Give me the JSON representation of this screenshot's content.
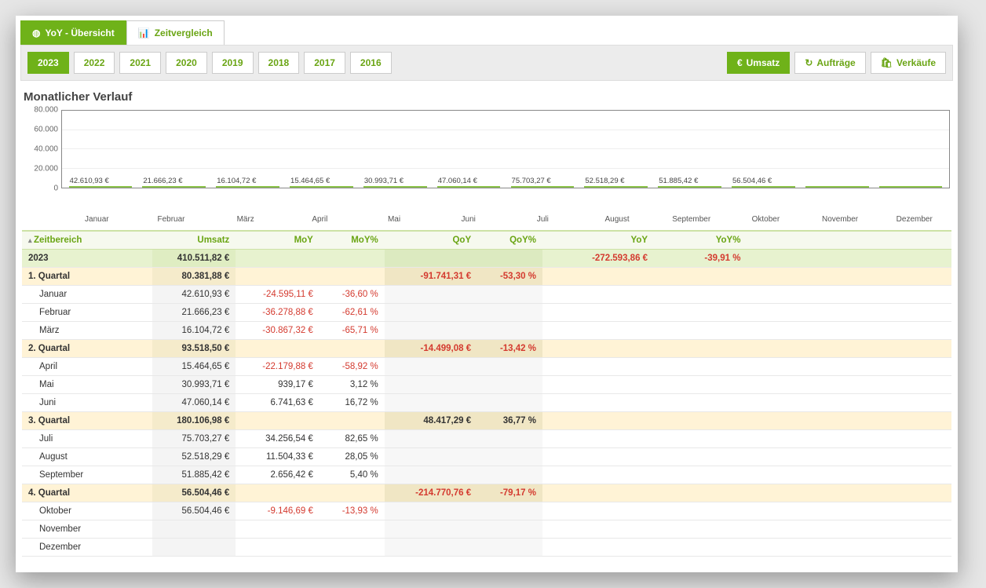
{
  "tabs_primary": [
    {
      "id": "overview",
      "label": "YoY - Übersicht",
      "active": true,
      "icon": "globe"
    },
    {
      "id": "compare",
      "label": "Zeitvergleich",
      "active": false,
      "icon": "chart"
    }
  ],
  "years": [
    "2023",
    "2022",
    "2021",
    "2020",
    "2019",
    "2018",
    "2017",
    "2016"
  ],
  "year_active": "2023",
  "metrics": [
    {
      "id": "umsatz",
      "label": "Umsatz",
      "icon": "€",
      "active": true
    },
    {
      "id": "auftraege",
      "label": "Aufträge",
      "icon": "↻",
      "active": false
    },
    {
      "id": "verkaeufe",
      "label": "Verkäufe",
      "icon": "🛍",
      "active": false
    }
  ],
  "chart_title": "Monatlicher Verlauf",
  "chart_data": {
    "type": "bar",
    "categories": [
      "Januar",
      "Februar",
      "März",
      "April",
      "Mai",
      "Juni",
      "Juli",
      "August",
      "September",
      "Oktober",
      "November",
      "Dezember"
    ],
    "values": [
      42610.93,
      21666.23,
      16104.72,
      15464.65,
      30993.71,
      47060.14,
      75703.27,
      52518.29,
      51885.42,
      56504.46,
      0,
      0
    ],
    "value_labels": [
      "42.610,93 €",
      "21.666,23 €",
      "16.104,72 €",
      "15.464,65 €",
      "30.993,71 €",
      "47.060,14 €",
      "75.703,27 €",
      "52.518,29 €",
      "51.885,42 €",
      "56.504,46 €",
      "",
      ""
    ],
    "ylabel": "",
    "xlabel": "",
    "ylim": [
      0,
      80000
    ],
    "y_ticks": [
      0,
      20000,
      40000,
      60000,
      80000
    ]
  },
  "table": {
    "columns": [
      "Zeitbereich",
      "Umsatz",
      "MoY",
      "MoY%",
      "QoY",
      "QoY%",
      "YoY",
      "YoY%"
    ],
    "rows": [
      {
        "level": "year",
        "range": "2023",
        "umsatz": "410.511,82 €",
        "moy": "",
        "moyp": "",
        "qoy": "",
        "qoyp": "",
        "yoy": "-272.593,86 €",
        "yoyp": "-39,91 %"
      },
      {
        "level": "quarter",
        "range": "1. Quartal",
        "umsatz": "80.381,88 €",
        "moy": "",
        "moyp": "",
        "qoy": "-91.741,31 €",
        "qoyp": "-53,30 %",
        "yoy": "",
        "yoyp": ""
      },
      {
        "level": "month",
        "range": "Januar",
        "umsatz": "42.610,93 €",
        "moy": "-24.595,11 €",
        "moyp": "-36,60 %",
        "qoy": "",
        "qoyp": "",
        "yoy": "",
        "yoyp": ""
      },
      {
        "level": "month",
        "range": "Februar",
        "umsatz": "21.666,23 €",
        "moy": "-36.278,88 €",
        "moyp": "-62,61 %",
        "qoy": "",
        "qoyp": "",
        "yoy": "",
        "yoyp": ""
      },
      {
        "level": "month",
        "range": "März",
        "umsatz": "16.104,72 €",
        "moy": "-30.867,32 €",
        "moyp": "-65,71 %",
        "qoy": "",
        "qoyp": "",
        "yoy": "",
        "yoyp": ""
      },
      {
        "level": "quarter",
        "range": "2. Quartal",
        "umsatz": "93.518,50 €",
        "moy": "",
        "moyp": "",
        "qoy": "-14.499,08 €",
        "qoyp": "-13,42 %",
        "yoy": "",
        "yoyp": ""
      },
      {
        "level": "month",
        "range": "April",
        "umsatz": "15.464,65 €",
        "moy": "-22.179,88 €",
        "moyp": "-58,92 %",
        "qoy": "",
        "qoyp": "",
        "yoy": "",
        "yoyp": ""
      },
      {
        "level": "month",
        "range": "Mai",
        "umsatz": "30.993,71 €",
        "moy": "939,17 €",
        "moyp": "3,12 %",
        "qoy": "",
        "qoyp": "",
        "yoy": "",
        "yoyp": ""
      },
      {
        "level": "month",
        "range": "Juni",
        "umsatz": "47.060,14 €",
        "moy": "6.741,63 €",
        "moyp": "16,72 %",
        "qoy": "",
        "qoyp": "",
        "yoy": "",
        "yoyp": ""
      },
      {
        "level": "quarter",
        "range": "3. Quartal",
        "umsatz": "180.106,98 €",
        "moy": "",
        "moyp": "",
        "qoy": "48.417,29 €",
        "qoyp": "36,77 %",
        "yoy": "",
        "yoyp": ""
      },
      {
        "level": "month",
        "range": "Juli",
        "umsatz": "75.703,27 €",
        "moy": "34.256,54 €",
        "moyp": "82,65 %",
        "qoy": "",
        "qoyp": "",
        "yoy": "",
        "yoyp": ""
      },
      {
        "level": "month",
        "range": "August",
        "umsatz": "52.518,29 €",
        "moy": "11.504,33 €",
        "moyp": "28,05 %",
        "qoy": "",
        "qoyp": "",
        "yoy": "",
        "yoyp": ""
      },
      {
        "level": "month",
        "range": "September",
        "umsatz": "51.885,42 €",
        "moy": "2.656,42 €",
        "moyp": "5,40 %",
        "qoy": "",
        "qoyp": "",
        "yoy": "",
        "yoyp": ""
      },
      {
        "level": "quarter",
        "range": "4. Quartal",
        "umsatz": "56.504,46 €",
        "moy": "",
        "moyp": "",
        "qoy": "-214.770,76 €",
        "qoyp": "-79,17 %",
        "yoy": "",
        "yoyp": ""
      },
      {
        "level": "month",
        "range": "Oktober",
        "umsatz": "56.504,46 €",
        "moy": "-9.146,69 €",
        "moyp": "-13,93 %",
        "qoy": "",
        "qoyp": "",
        "yoy": "",
        "yoyp": ""
      },
      {
        "level": "month",
        "range": "November",
        "umsatz": "",
        "moy": "",
        "moyp": "",
        "qoy": "",
        "qoyp": "",
        "yoy": "",
        "yoyp": ""
      },
      {
        "level": "month",
        "range": "Dezember",
        "umsatz": "",
        "moy": "",
        "moyp": "",
        "qoy": "",
        "qoyp": "",
        "yoy": "",
        "yoyp": ""
      }
    ]
  }
}
